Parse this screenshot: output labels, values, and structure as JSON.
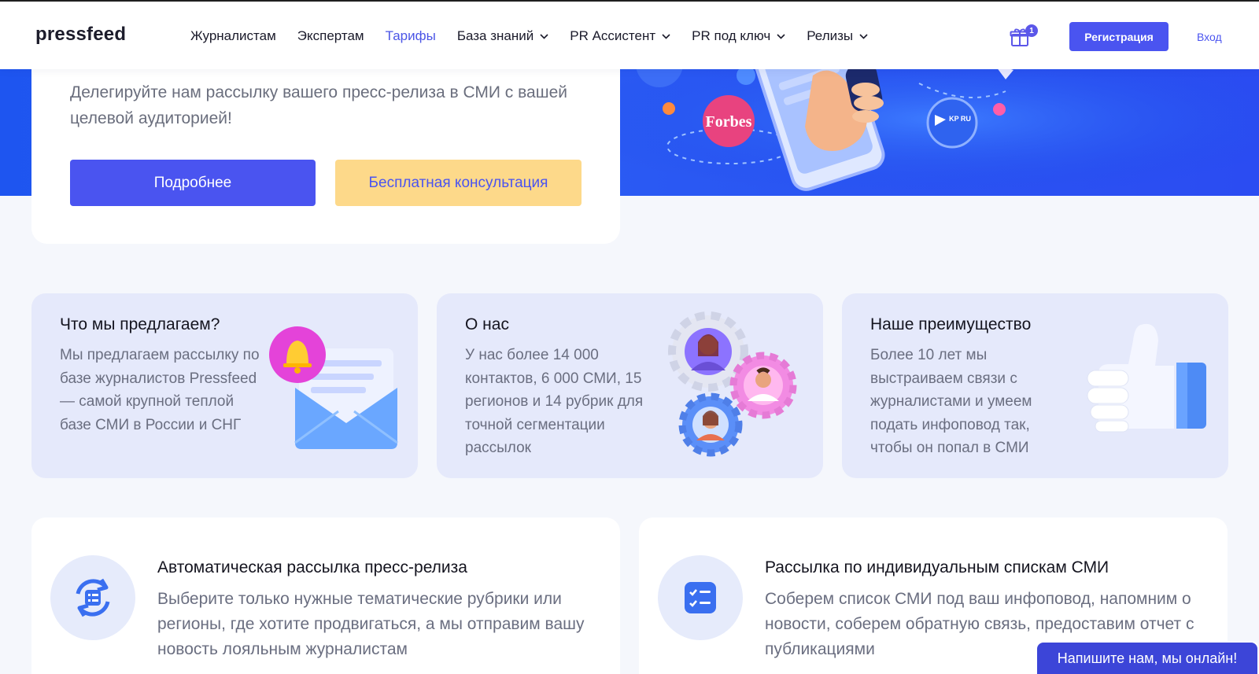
{
  "header": {
    "logo": "pressfeed",
    "nav": [
      {
        "label": "Журналистам",
        "active": false,
        "dropdown": false
      },
      {
        "label": "Экспертам",
        "active": false,
        "dropdown": false
      },
      {
        "label": "Тарифы",
        "active": true,
        "dropdown": false
      },
      {
        "label": "База знаний",
        "active": false,
        "dropdown": true
      },
      {
        "label": "PR Ассистент",
        "active": false,
        "dropdown": true
      },
      {
        "label": "PR под ключ",
        "active": false,
        "dropdown": true
      },
      {
        "label": "Релизы",
        "active": false,
        "dropdown": true
      }
    ],
    "gift_badge": "1",
    "register_label": "Регистрация",
    "login_label": "Вход"
  },
  "hero": {
    "text": "Делегируйте нам рассылку вашего пресс-релиза в СМИ с вашей целевой аудиторией!",
    "btn_more": "Подробнее",
    "btn_consult": "Бесплатная консультация",
    "forbes": "Forbes",
    "kp": "KP RU"
  },
  "features": [
    {
      "title": "Что мы предлагаем?",
      "text": "Мы предлагаем рассылку по базе журналистов Pressfeed — самой крупной теплой базе СМИ в России и СНГ"
    },
    {
      "title": "О нас",
      "text": "У нас более 14 000 контактов, 6 000 СМИ, 15 регионов и 14 рубрик для точной сегментации рассылок"
    },
    {
      "title": "Наше преимущество",
      "text": "Более 10 лет мы выстраиваем связи с журналистами и умеем подать инфоповод так, чтобы он попал в СМИ"
    }
  ],
  "services": [
    {
      "title": "Автоматическая рассылка пресс-релиза",
      "text": "Выберите только нужные тематические рубрики или регионы, где хотите продвигаться, а мы отправим вашу новость лояльным журналистам"
    },
    {
      "title": "Рассылка по индивидуальным спискам СМИ",
      "text": "Соберем список СМИ под ваш инфоповод, напомним о новости, соберем обратную связь, предоставим отчет с публикациями"
    }
  ],
  "chat_label": "Напишите нам, мы онлайн!",
  "colors": {
    "accent": "#4a54f0",
    "consult_bg": "#fdd98a",
    "card_bg": "#e5e9fb"
  }
}
